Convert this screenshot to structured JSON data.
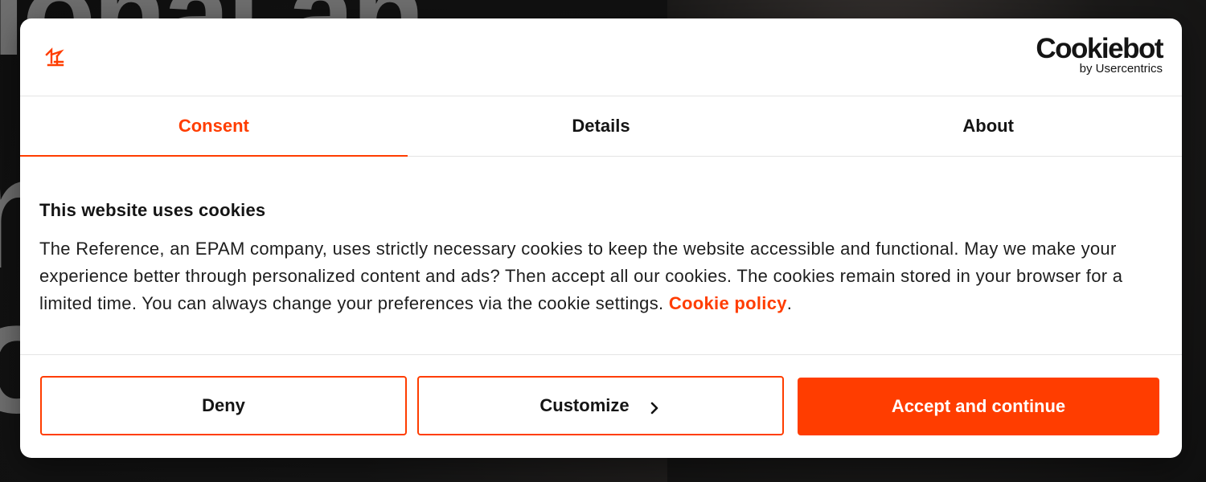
{
  "colors": {
    "accent": "#ff3d00",
    "text": "#141414",
    "background": "#ffffff"
  },
  "header": {
    "brand_icon": "the-reference-logo-icon",
    "cookiebot_name": "Cookiebot",
    "cookiebot_by": "by Usercentrics"
  },
  "tabs": [
    {
      "label": "Consent",
      "active": true
    },
    {
      "label": "Details",
      "active": false
    },
    {
      "label": "About",
      "active": false
    }
  ],
  "content": {
    "title": "This website uses cookies",
    "body": "The Reference, an EPAM company, uses strictly necessary cookies to keep the website accessible and functional. May we make your experience better through personalized content and ads? Then accept all our cookies. The cookies remain stored in your browser for a limited time. You can always change your preferences via the cookie settings.",
    "link_label": "Cookie policy",
    "link_suffix": "."
  },
  "buttons": {
    "deny": "Deny",
    "customize": "Customize",
    "customize_icon": "chevron-right-icon",
    "accept": "Accept and continue"
  }
}
